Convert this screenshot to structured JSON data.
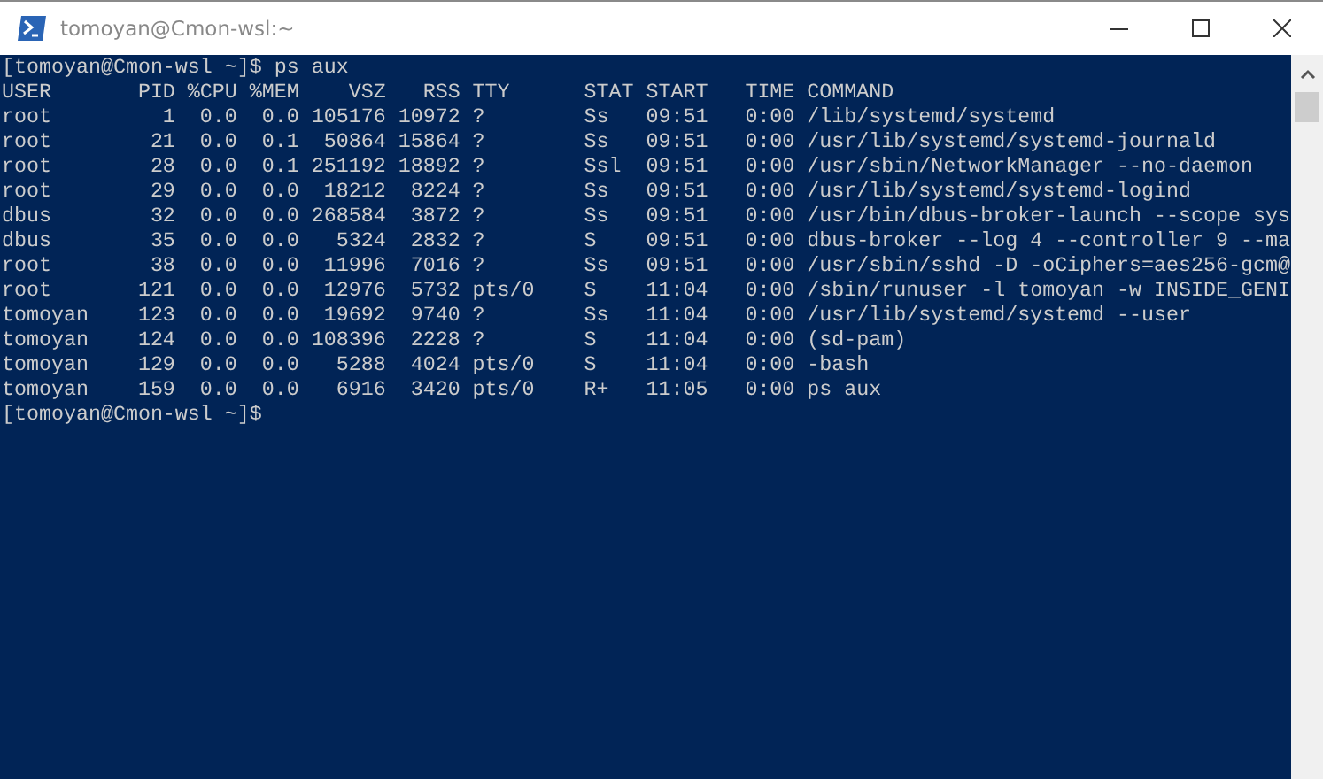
{
  "window": {
    "title": "tomoyan@Cmon-wsl:~"
  },
  "terminal": {
    "lines": [
      "[tomoyan@Cmon-wsl ~]$ ps aux",
      "USER       PID %CPU %MEM    VSZ   RSS TTY      STAT START   TIME COMMAND",
      "root         1  0.0  0.0 105176 10972 ?        Ss   09:51   0:00 /lib/systemd/systemd",
      "root        21  0.0  0.1  50864 15864 ?        Ss   09:51   0:00 /usr/lib/systemd/systemd-journald",
      "root        28  0.0  0.1 251192 18892 ?        Ssl  09:51   0:00 /usr/sbin/NetworkManager --no-daemon",
      "root        29  0.0  0.0  18212  8224 ?        Ss   09:51   0:00 /usr/lib/systemd/systemd-logind",
      "dbus        32  0.0  0.0 268584  3872 ?        Ss   09:51   0:00 /usr/bin/dbus-broker-launch --scope sys",
      "dbus        35  0.0  0.0   5324  2832 ?        S    09:51   0:00 dbus-broker --log 4 --controller 9 --ma",
      "root        38  0.0  0.0  11996  7016 ?        Ss   09:51   0:00 /usr/sbin/sshd -D -oCiphers=aes256-gcm@",
      "root       121  0.0  0.0  12976  5732 pts/0    S    11:04   0:00 /sbin/runuser -l tomoyan -w INSIDE_GENI",
      "tomoyan    123  0.0  0.0  19692  9740 ?        Ss   11:04   0:00 /usr/lib/systemd/systemd --user",
      "tomoyan    124  0.0  0.0 108396  2228 ?        S    11:04   0:00 (sd-pam)",
      "tomoyan    129  0.0  0.0   5288  4024 pts/0    S    11:04   0:00 -bash",
      "tomoyan    159  0.0  0.0   6916  3420 pts/0    R+   11:05   0:00 ps aux",
      "[tomoyan@Cmon-wsl ~]$"
    ]
  }
}
